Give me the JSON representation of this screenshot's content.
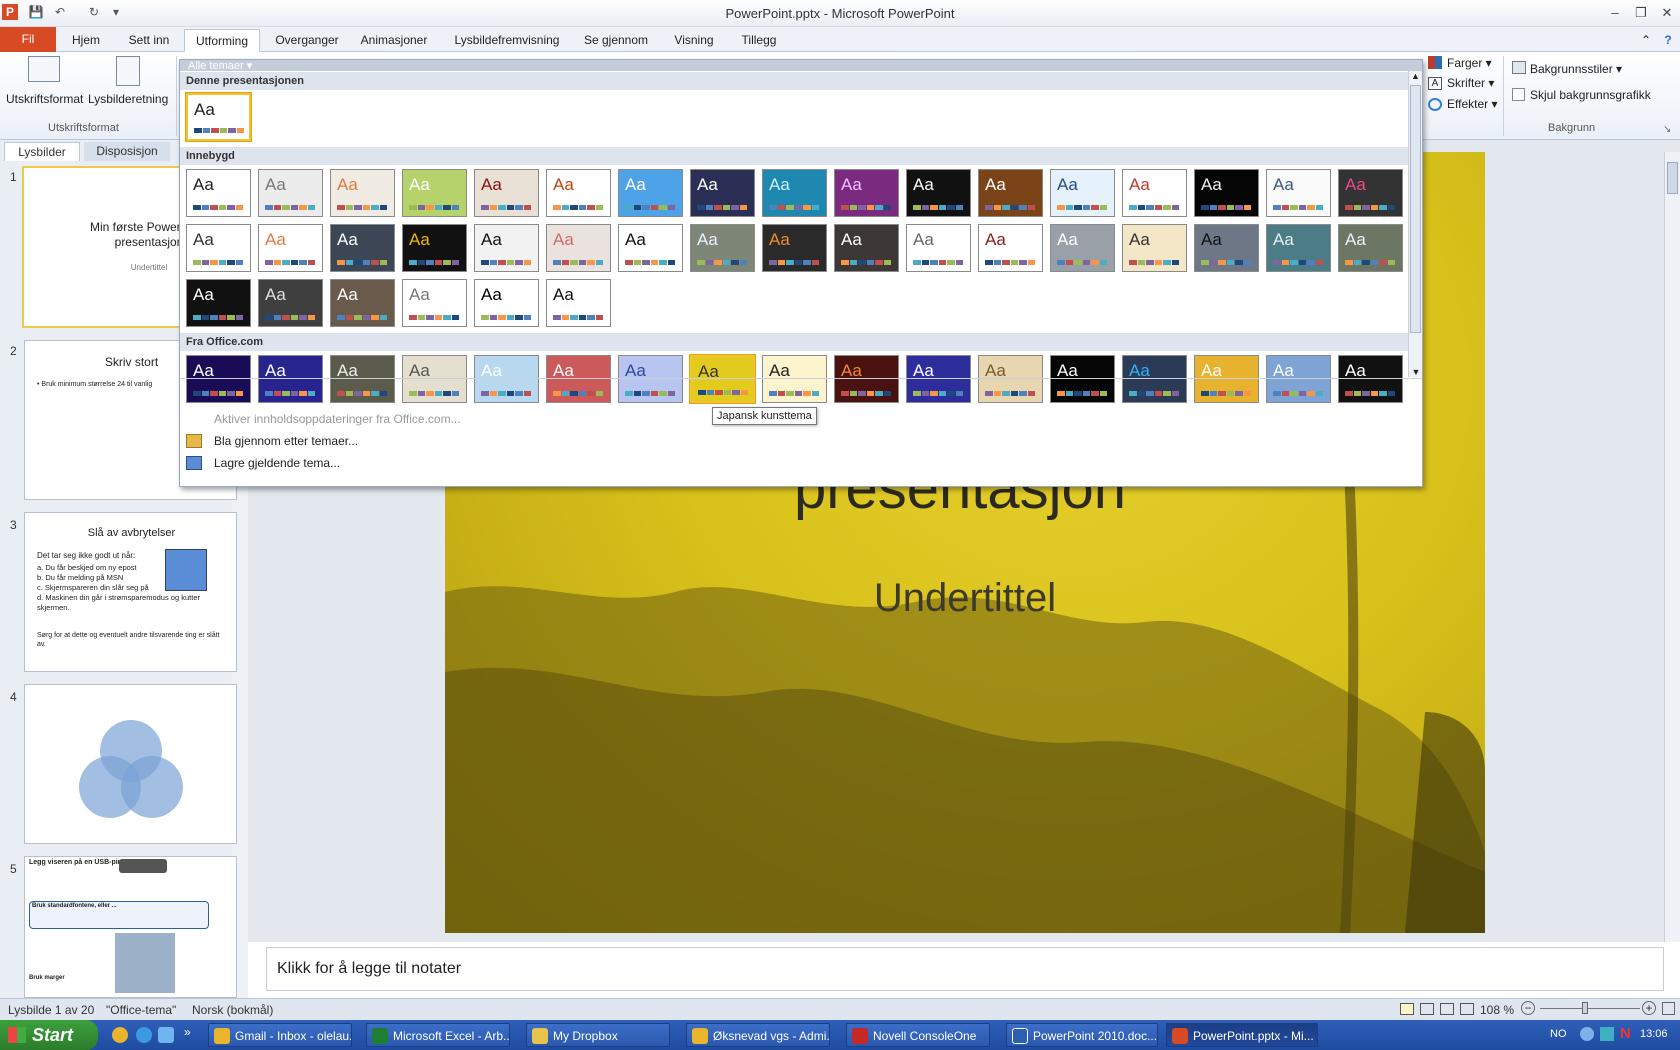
{
  "window": {
    "title": "PowerPoint.pptx  -  Microsoft PowerPoint"
  },
  "tabs": [
    "Fil",
    "Hjem",
    "Sett inn",
    "Utforming",
    "Overganger",
    "Animasjoner",
    "Lysbildefremvisning",
    "Se gjennom",
    "Visning",
    "Tillegg"
  ],
  "ribbon": {
    "utskriftsformat": "Utskriftsformat",
    "lysbilderetning": "Lysbilderetning",
    "group_utskrift": "Utskriftsformat",
    "farger": "Farger",
    "skrifter": "Skrifter",
    "effekter": "Effekter",
    "bakgrunnsstiler": "Bakgrunnsstiler",
    "skjul": "Skjul bakgrunnsgrafikk",
    "group_bakgrunn": "Bakgrunn"
  },
  "panel": {
    "tab_slides": "Lysbilder",
    "tab_outline": "Disposisjon"
  },
  "slides": [
    {
      "num": "1",
      "title": "Min første PowerPoint presentasjon",
      "sub": "Undertittel"
    },
    {
      "num": "2",
      "title": "Skriv stort",
      "bullet": "Bruk minimum størrelse 24 til vanlig"
    },
    {
      "num": "3",
      "title": "Slå av avbrytelser",
      "intro": "Det tar seg ikke godt ut når:",
      "items": [
        "Du får beskjed om ny epost",
        "Du får melding på MSN",
        "Skjermspareren din slår seg på",
        "Maskinen din går i strømsparemodus og kutter skjermen."
      ],
      "outro": "Sørg for at dette og eventuelt andre tilsvarende ting er slått av."
    },
    {
      "num": "4"
    },
    {
      "num": "5",
      "title": "Legg viseren på en USB-pinne",
      "h2": "Bruk standardfontene, eller ...",
      "h3": "Bruk marger"
    }
  ],
  "gallery": {
    "filter": "Alle temaer",
    "section_current": "Denne presentasjonen",
    "section_builtin": "Innebygd",
    "section_office": "Fra Office.com",
    "aa": "Aa",
    "tooltip": "Japansk kunsttema",
    "menu_update": "Aktiver innholdsoppdateringer fra Office.com...",
    "menu_browse": "Bla gjennom etter temaer...",
    "menu_save": "Lagre gjeldende tema..."
  },
  "main_slide": {
    "title": "presentasjon",
    "subtitle": "Undertittel"
  },
  "notes": {
    "placeholder": "Klikk for å legge til notater"
  },
  "status": {
    "slide": "Lysbilde 1 av 20",
    "theme": "\"Office-tema\"",
    "lang": "Norsk (bokmål)",
    "zoom": "108 %"
  },
  "taskbar": {
    "start": "Start",
    "items": [
      "Gmail - Inbox - olelau...",
      "Microsoft Excel - Arb...",
      "My Dropbox",
      "Øksnevad vgs - Admi...",
      "Novell ConsoleOne",
      "PowerPoint 2010.doc...",
      "PowerPoint.pptx - Mi..."
    ],
    "lang": "NO",
    "time": "13:06"
  },
  "colors": {
    "file_tab": "#d84a24",
    "slide_yellow": "#d9c11b",
    "taskbar": "#2a58ad"
  }
}
